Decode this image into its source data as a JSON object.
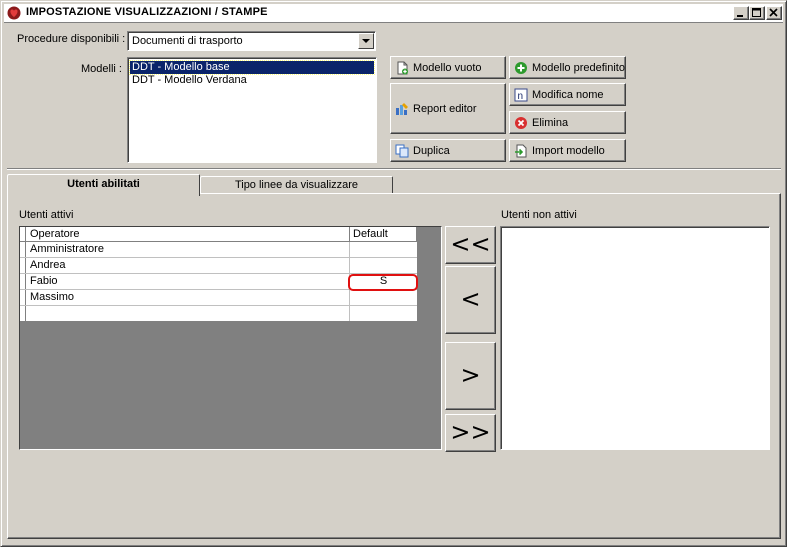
{
  "window": {
    "title": "IMPOSTAZIONE VISUALIZZAZIONI / STAMPE",
    "icon": "app-heart-icon",
    "controls": [
      "minimize-icon",
      "maximize-icon",
      "close-icon"
    ]
  },
  "procedure": {
    "label": "Procedure disponibili :",
    "selected": "Documenti di trasporto"
  },
  "modelli": {
    "label": "Modelli :",
    "items": [
      {
        "label": "DDT - Modello base",
        "selected": true
      },
      {
        "label": "DDT - Modello Verdana",
        "selected": false
      }
    ]
  },
  "buttons": {
    "modello_vuoto": {
      "label": "Modello vuoto",
      "icon": "new-document-icon"
    },
    "modello_predefinito": {
      "label": "Modello predefinito",
      "icon": "green-plus-icon"
    },
    "report_editor": {
      "label": "Report editor",
      "icon": "report-editor-icon"
    },
    "modifica_nome": {
      "label": "Modifica nome",
      "icon": "rename-icon"
    },
    "elimina": {
      "label": "Elimina",
      "icon": "red-delete-icon"
    },
    "duplica": {
      "label": "Duplica",
      "icon": "duplicate-icon"
    },
    "import_modello": {
      "label": "Import modello",
      "icon": "import-icon"
    }
  },
  "tabs": [
    {
      "label": "Utenti abilitati",
      "active": true
    },
    {
      "label": "Tipo linee da visualizzare",
      "active": false
    }
  ],
  "utenti_attivi": {
    "label": "Utenti attivi",
    "columns": [
      "Operatore",
      "Default"
    ],
    "rows": [
      {
        "operatore": "Amministratore",
        "default": ""
      },
      {
        "operatore": "Andrea",
        "default": ""
      },
      {
        "operatore": "Fabio",
        "default": "S"
      },
      {
        "operatore": "Massimo",
        "default": ""
      }
    ]
  },
  "move_buttons": {
    "all_left": "<<",
    "left": "<",
    "right": ">",
    "all_right": ">>"
  },
  "utenti_non_attivi": {
    "label": "Utenti non attivi",
    "items": []
  },
  "colors": {
    "face": "#d4d0c8",
    "selection": "#0a246a",
    "highlight_ring": "#e01010"
  }
}
